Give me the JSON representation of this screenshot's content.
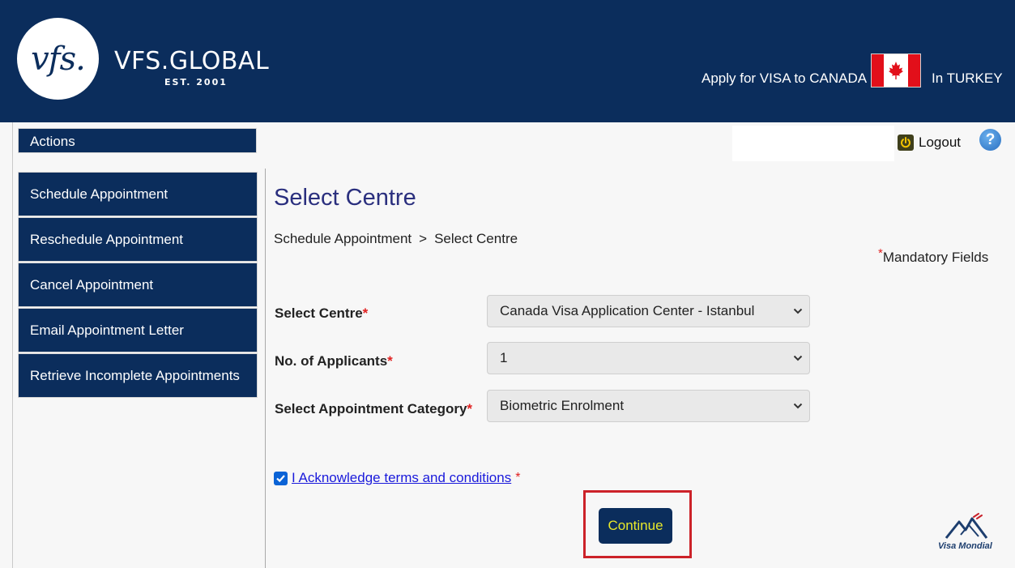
{
  "header": {
    "logo_mark": "vfs.",
    "brand_name": "VFS.GLOBAL",
    "brand_est": "EST. 2001",
    "apply_text": "Apply for VISA to CANADA",
    "country_text": "In TURKEY",
    "flag_icon": "canada-flag-icon"
  },
  "topbar": {
    "actions_label": "Actions",
    "logout_label": "Logout",
    "help_label": "?"
  },
  "sidebar": {
    "items": [
      {
        "label": "Schedule Appointment"
      },
      {
        "label": "Reschedule Appointment"
      },
      {
        "label": "Cancel Appointment"
      },
      {
        "label": "Email Appointment Letter"
      },
      {
        "label": "Retrieve Incomplete Appointments"
      }
    ]
  },
  "main": {
    "title": "Select Centre",
    "breadcrumb": {
      "parent": "Schedule Appointment",
      "separator": ">",
      "current": "Select Centre"
    },
    "mandatory_label": "Mandatory Fields",
    "required_mark": "*",
    "form": {
      "centre_label": "Select Centre",
      "centre_value": "Canada Visa Application Center - Istanbul",
      "applicants_label": "No. of Applicants",
      "applicants_value": "1",
      "category_label": "Select Appointment Category",
      "category_value": "Biometric Enrolment"
    },
    "acknowledge": {
      "checked": true,
      "label": "I Acknowledge terms and conditions "
    },
    "continue_label": "Continue"
  },
  "footer": {
    "partner_name": "Visa Mondial"
  },
  "colors": {
    "navy": "#0b2d5c",
    "title": "#2a2f7e",
    "required": "#e02020",
    "button_text": "#e8e82a",
    "highlight": "#cc2229"
  }
}
